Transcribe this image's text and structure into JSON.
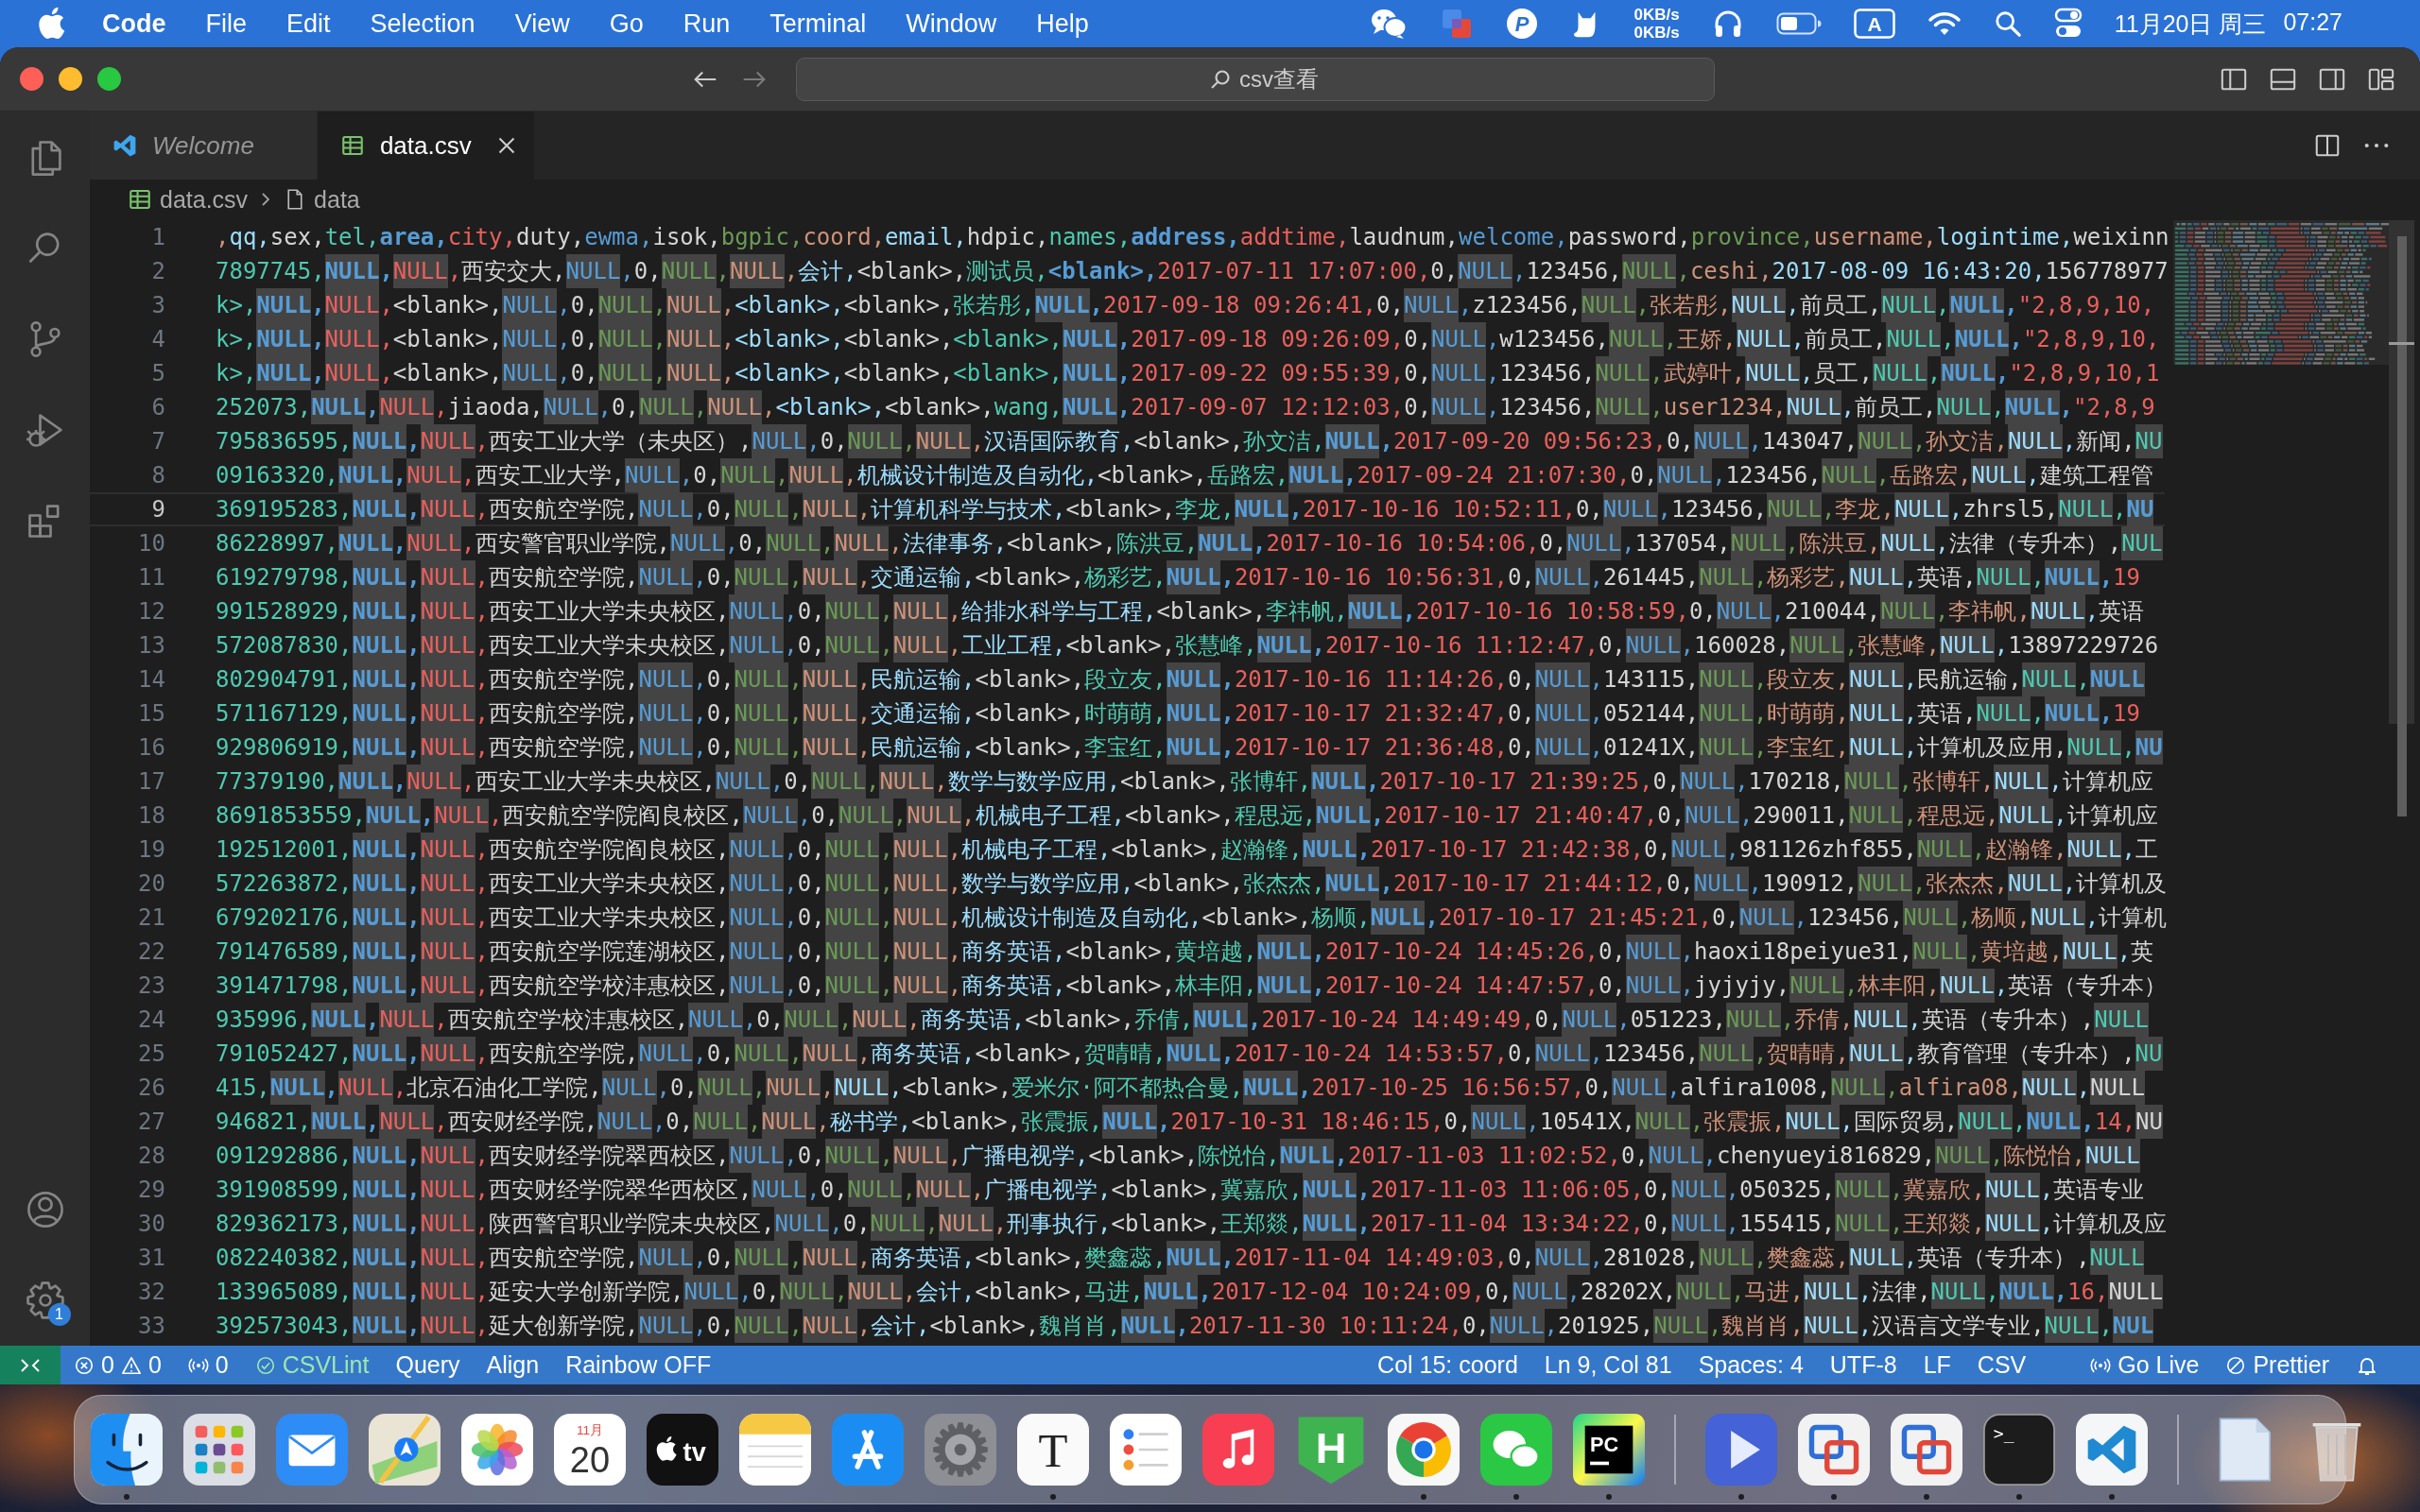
{
  "menu_bar": {
    "app_name": "Code",
    "menus": [
      "File",
      "Edit",
      "Selection",
      "View",
      "Go",
      "Run",
      "Terminal",
      "Window",
      "Help"
    ],
    "tray_letter": "P",
    "network_speed": [
      "0KB/s",
      "0KB/s"
    ],
    "input_source": "A",
    "date": "11月20日 周三",
    "time": "07:27"
  },
  "title_bar": {
    "command_center": "csv查看"
  },
  "activity_bar": {
    "settings_badge": "1"
  },
  "tabs": [
    {
      "label": "Welcome",
      "kind": "welcome",
      "selected": false,
      "preview": true
    },
    {
      "label": "data.csv",
      "kind": "csv",
      "selected": true,
      "preview": false
    }
  ],
  "breadcrumbs": [
    {
      "label": "data.csv",
      "kind": "csv"
    },
    {
      "label": "data",
      "kind": "symbol"
    }
  ],
  "editor": {
    "lines": [
      {
        "number": "1",
        "kind": "header",
        "current": false,
        "text": ",qq,sex,tel,area,city,duty,ewma,isok,bgpic,coord,email,hdpic,names,address,addtime,laudnum,welcome,password,province,username,logintime,weixinn",
        "highlighted": [
          false,
          false,
          false,
          false,
          false,
          false,
          false,
          false,
          false,
          false,
          false,
          false,
          false,
          false,
          false,
          false,
          false,
          false,
          false,
          false,
          false,
          false,
          false
        ]
      },
      {
        "number": "2",
        "kind": "record",
        "current": false,
        "text": "7897745,NULL,NULL,西安交大,NULL,0,NULL,NULL,会计,<blank>,测试员,<blank>,2017-07-11 17:07:00,0,NULL,123456,NULL,ceshi,2017-08-09 16:43:20,156778977",
        "highlighted": [
          false,
          true,
          true,
          false,
          true,
          false,
          true,
          true,
          false,
          false,
          false,
          false,
          false,
          false,
          true,
          false,
          true,
          false,
          false,
          false
        ]
      },
      {
        "number": "3",
        "kind": "record",
        "current": false,
        "text": "k>,NULL,NULL,<blank>,NULL,0,NULL,NULL,<blank>,<blank>,张若彤,NULL,2017-09-18 09:26:41,0,NULL,z123456,NULL,张若彤,NULL,前员工,NULL,NULL,\"2,8,9,10,",
        "highlighted": [
          false,
          true,
          true,
          false,
          true,
          false,
          true,
          true,
          false,
          false,
          false,
          true,
          false,
          false,
          true,
          false,
          true,
          false,
          true,
          false,
          true,
          true,
          false
        ]
      },
      {
        "number": "4",
        "kind": "record",
        "current": false,
        "text": "k>,NULL,NULL,<blank>,NULL,0,NULL,NULL,<blank>,<blank>,<blank>,NULL,2017-09-18 09:26:09,0,NULL,w123456,NULL,王娇,NULL,前员工,NULL,NULL,\"2,8,9,10,",
        "highlighted": [
          false,
          true,
          true,
          false,
          true,
          false,
          true,
          true,
          false,
          false,
          false,
          true,
          false,
          false,
          true,
          false,
          true,
          false,
          true,
          false,
          true,
          true,
          false
        ]
      },
      {
        "number": "5",
        "kind": "record",
        "current": false,
        "text": "k>,NULL,NULL,<blank>,NULL,0,NULL,NULL,<blank>,<blank>,<blank>,NULL,2017-09-22 09:55:39,0,NULL,123456,NULL,武婷叶,NULL,员工,NULL,NULL,\"2,8,9,10,1",
        "highlighted": [
          false,
          true,
          true,
          false,
          true,
          false,
          true,
          true,
          false,
          false,
          false,
          true,
          false,
          false,
          true,
          false,
          true,
          false,
          true,
          false,
          true,
          true,
          false
        ]
      },
      {
        "number": "6",
        "kind": "record",
        "current": false,
        "text": "252073,NULL,NULL,jiaoda,NULL,0,NULL,NULL,<blank>,<blank>,wang,NULL,2017-09-07 12:12:03,0,NULL,123456,NULL,user1234,NULL,前员工,NULL,NULL,\"2,8,9",
        "highlighted": [
          false,
          true,
          true,
          false,
          true,
          false,
          true,
          true,
          false,
          false,
          false,
          true,
          false,
          false,
          true,
          false,
          true,
          false,
          true,
          false,
          true,
          true,
          false
        ]
      },
      {
        "number": "7",
        "kind": "record",
        "current": false,
        "text": "795836595,NULL,NULL,西安工业大学（未央区）,NULL,0,NULL,NULL,汉语国际教育,<blank>,孙文洁,NULL,2017-09-20 09:56:23,0,NULL,143047,NULL,孙文洁,NULL,新闻,NU",
        "highlighted": [
          false,
          true,
          true,
          false,
          true,
          false,
          true,
          true,
          false,
          false,
          false,
          true,
          false,
          false,
          true,
          false,
          true,
          false,
          true,
          false,
          true
        ]
      },
      {
        "number": "8",
        "kind": "record",
        "current": false,
        "text": "09163320,NULL,NULL,西安工业大学,NULL,0,NULL,NULL,机械设计制造及自动化,<blank>,岳路宏,NULL,2017-09-24 21:07:30,0,NULL,123456,NULL,岳路宏,NULL,建筑工程管",
        "highlighted": [
          false,
          true,
          true,
          false,
          true,
          false,
          true,
          true,
          false,
          false,
          false,
          true,
          false,
          false,
          true,
          false,
          true,
          false,
          true,
          false
        ]
      },
      {
        "number": "9",
        "kind": "record",
        "current": true,
        "text": "369195283,NULL,NULL,西安航空学院,NULL,0,NULL,NULL,计算机科学与技术,<blank>,李龙,NULL,2017-10-16 10:52:11,0,NULL,123456,NULL,李龙,NULL,zhrsl5,NULL,NU",
        "highlighted": [
          false,
          true,
          true,
          false,
          true,
          false,
          true,
          true,
          false,
          false,
          false,
          true,
          false,
          false,
          true,
          false,
          true,
          false,
          true,
          false,
          true,
          true
        ]
      },
      {
        "number": "10",
        "kind": "record",
        "current": false,
        "text": "86228997,NULL,NULL,西安警官职业学院,NULL,0,NULL,NULL,法律事务,<blank>,陈洪豆,NULL,2017-10-16 10:54:06,0,NULL,137054,NULL,陈洪豆,NULL,法律（专升本）,NUL",
        "highlighted": [
          false,
          true,
          true,
          false,
          true,
          false,
          true,
          true,
          false,
          false,
          false,
          true,
          false,
          false,
          true,
          false,
          true,
          false,
          true,
          false,
          true
        ]
      },
      {
        "number": "11",
        "kind": "record",
        "current": false,
        "text": "619279798,NULL,NULL,西安航空学院,NULL,0,NULL,NULL,交通运输,<blank>,杨彩艺,NULL,2017-10-16 10:56:31,0,NULL,261445,NULL,杨彩艺,NULL,英语,NULL,NULL,19",
        "highlighted": [
          false,
          true,
          true,
          false,
          true,
          false,
          true,
          true,
          false,
          false,
          false,
          true,
          false,
          false,
          true,
          false,
          true,
          false,
          true,
          false,
          true,
          true,
          false
        ]
      },
      {
        "number": "12",
        "kind": "record",
        "current": false,
        "text": "991528929,NULL,NULL,西安工业大学未央校区,NULL,0,NULL,NULL,给排水科学与工程,<blank>,李祎帆,NULL,2017-10-16 10:58:59,0,NULL,210044,NULL,李祎帆,NULL,英语",
        "highlighted": [
          false,
          true,
          true,
          false,
          true,
          false,
          true,
          true,
          false,
          false,
          false,
          true,
          false,
          false,
          true,
          false,
          true,
          false,
          true,
          false
        ]
      },
      {
        "number": "13",
        "kind": "record",
        "current": false,
        "text": "572087830,NULL,NULL,西安工业大学未央校区,NULL,0,NULL,NULL,工业工程,<blank>,张慧峰,NULL,2017-10-16 11:12:47,0,NULL,160028,NULL,张慧峰,NULL,13897229726",
        "highlighted": [
          false,
          true,
          true,
          false,
          true,
          false,
          true,
          true,
          false,
          false,
          false,
          true,
          false,
          false,
          true,
          false,
          true,
          false,
          true,
          false
        ]
      },
      {
        "number": "14",
        "kind": "record",
        "current": false,
        "text": "802904791,NULL,NULL,西安航空学院,NULL,0,NULL,NULL,民航运输,<blank>,段立友,NULL,2017-10-16 11:14:26,0,NULL,143115,NULL,段立友,NULL,民航运输,NULL,NULL",
        "highlighted": [
          false,
          true,
          true,
          false,
          true,
          false,
          true,
          true,
          false,
          false,
          false,
          true,
          false,
          false,
          true,
          false,
          true,
          false,
          true,
          false,
          true,
          true
        ]
      },
      {
        "number": "15",
        "kind": "record",
        "current": false,
        "text": "571167129,NULL,NULL,西安航空学院,NULL,0,NULL,NULL,交通运输,<blank>,时萌萌,NULL,2017-10-17 21:32:47,0,NULL,052144,NULL,时萌萌,NULL,英语,NULL,NULL,19",
        "highlighted": [
          false,
          true,
          true,
          false,
          true,
          false,
          true,
          true,
          false,
          false,
          false,
          true,
          false,
          false,
          true,
          false,
          true,
          false,
          true,
          false,
          true,
          true,
          false
        ]
      },
      {
        "number": "16",
        "kind": "record",
        "current": false,
        "text": "929806919,NULL,NULL,西安航空学院,NULL,0,NULL,NULL,民航运输,<blank>,李宝红,NULL,2017-10-17 21:36:48,0,NULL,01241X,NULL,李宝红,NULL,计算机及应用,NULL,NU",
        "highlighted": [
          false,
          true,
          true,
          false,
          true,
          false,
          true,
          true,
          false,
          false,
          false,
          true,
          false,
          false,
          true,
          false,
          true,
          false,
          true,
          false,
          true,
          true
        ]
      },
      {
        "number": "17",
        "kind": "record",
        "current": false,
        "text": "77379190,NULL,NULL,西安工业大学未央校区,NULL,0,NULL,NULL,数学与数学应用,<blank>,张博轩,NULL,2017-10-17 21:39:25,0,NULL,170218,NULL,张博轩,NULL,计算机应",
        "highlighted": [
          false,
          true,
          true,
          false,
          true,
          false,
          true,
          true,
          false,
          false,
          false,
          true,
          false,
          false,
          true,
          false,
          true,
          false,
          true,
          false
        ]
      },
      {
        "number": "18",
        "kind": "record",
        "current": false,
        "text": "8691853559,NULL,NULL,西安航空学院阎良校区,NULL,0,NULL,NULL,机械电子工程,<blank>,程思远,NULL,2017-10-17 21:40:47,0,NULL,290011,NULL,程思远,NULL,计算机应",
        "highlighted": [
          false,
          true,
          true,
          false,
          true,
          false,
          true,
          true,
          false,
          false,
          false,
          true,
          false,
          false,
          true,
          false,
          true,
          false,
          true,
          false
        ]
      },
      {
        "number": "19",
        "kind": "record",
        "current": false,
        "text": "192512001,NULL,NULL,西安航空学院阎良校区,NULL,0,NULL,NULL,机械电子工程,<blank>,赵瀚锋,NULL,2017-10-17 21:42:38,0,NULL,981126zhf855,NULL,赵瀚锋,NULL,工",
        "highlighted": [
          false,
          true,
          true,
          false,
          true,
          false,
          true,
          true,
          false,
          false,
          false,
          true,
          false,
          false,
          true,
          false,
          true,
          false,
          true,
          false
        ]
      },
      {
        "number": "20",
        "kind": "record",
        "current": false,
        "text": "572263872,NULL,NULL,西安工业大学未央校区,NULL,0,NULL,NULL,数学与数学应用,<blank>,张杰杰,NULL,2017-10-17 21:44:12,0,NULL,190912,NULL,张杰杰,NULL,计算机及",
        "highlighted": [
          false,
          true,
          true,
          false,
          true,
          false,
          true,
          true,
          false,
          false,
          false,
          true,
          false,
          false,
          true,
          false,
          true,
          false,
          true,
          false
        ]
      },
      {
        "number": "21",
        "kind": "record",
        "current": false,
        "text": "679202176,NULL,NULL,西安工业大学未央校区,NULL,0,NULL,NULL,机械设计制造及自动化,<blank>,杨顺,NULL,2017-10-17 21:45:21,0,NULL,123456,NULL,杨顺,NULL,计算机",
        "highlighted": [
          false,
          true,
          true,
          false,
          true,
          false,
          true,
          true,
          false,
          false,
          false,
          true,
          false,
          false,
          true,
          false,
          true,
          false,
          true,
          false
        ]
      },
      {
        "number": "22",
        "kind": "record",
        "current": false,
        "text": "791476589,NULL,NULL,西安航空学院莲湖校区,NULL,0,NULL,NULL,商务英语,<blank>,黄培越,NULL,2017-10-24 14:45:26,0,NULL,haoxi18peiyue31,NULL,黄培越,NULL,英",
        "highlighted": [
          false,
          true,
          true,
          false,
          true,
          false,
          true,
          true,
          false,
          false,
          false,
          true,
          false,
          false,
          true,
          false,
          true,
          false,
          true,
          false
        ]
      },
      {
        "number": "23",
        "kind": "record",
        "current": false,
        "text": "391471798,NULL,NULL,西安航空学校沣惠校区,NULL,0,NULL,NULL,商务英语,<blank>,林丰阳,NULL,2017-10-24 14:47:57,0,NULL,jyjyjy,NULL,林丰阳,NULL,英语（专升本）",
        "highlighted": [
          false,
          true,
          true,
          false,
          true,
          false,
          true,
          true,
          false,
          false,
          false,
          true,
          false,
          false,
          true,
          false,
          true,
          false,
          true,
          false
        ]
      },
      {
        "number": "24",
        "kind": "record",
        "current": false,
        "text": "935996,NULL,NULL,西安航空学校沣惠校区,NULL,0,NULL,NULL,商务英语,<blank>,乔倩,NULL,2017-10-24 14:49:49,0,NULL,051223,NULL,乔倩,NULL,英语（专升本）,NULL",
        "highlighted": [
          false,
          true,
          true,
          false,
          true,
          false,
          true,
          true,
          false,
          false,
          false,
          true,
          false,
          false,
          true,
          false,
          true,
          false,
          true,
          false,
          true
        ]
      },
      {
        "number": "25",
        "kind": "record",
        "current": false,
        "text": "791052427,NULL,NULL,西安航空学院,NULL,0,NULL,NULL,商务英语,<blank>,贺晴晴,NULL,2017-10-24 14:53:57,0,NULL,123456,NULL,贺晴晴,NULL,教育管理（专升本）,NU",
        "highlighted": [
          false,
          true,
          true,
          false,
          true,
          false,
          true,
          true,
          false,
          false,
          false,
          true,
          false,
          false,
          true,
          false,
          true,
          false,
          true,
          false,
          true
        ]
      },
      {
        "number": "26",
        "kind": "record",
        "current": false,
        "text": "415,NULL,NULL,北京石油化工学院,NULL,0,NULL,NULL,NULL,<blank>,爱米尔·阿不都热合曼,NULL,2017-10-25 16:56:57,0,NULL,alfira1008,NULL,alfira08,NULL,NULL",
        "highlighted": [
          false,
          true,
          true,
          false,
          true,
          false,
          true,
          true,
          true,
          false,
          false,
          true,
          false,
          false,
          true,
          false,
          true,
          false,
          true,
          true
        ]
      },
      {
        "number": "27",
        "kind": "record",
        "current": false,
        "text": "946821,NULL,NULL,西安财经学院,NULL,0,NULL,NULL,秘书学,<blank>,张震振,NULL,2017-10-31 18:46:15,0,NULL,10541X,NULL,张震振,NULL,国际贸易,NULL,NULL,14,NU",
        "highlighted": [
          false,
          true,
          true,
          false,
          true,
          false,
          true,
          true,
          false,
          false,
          false,
          true,
          false,
          false,
          true,
          false,
          true,
          false,
          true,
          false,
          true,
          true,
          false,
          true
        ]
      },
      {
        "number": "28",
        "kind": "record",
        "current": false,
        "text": "091292886,NULL,NULL,西安财经学院翠西校区,NULL,0,NULL,NULL,广播电视学,<blank>,陈悦怡,NULL,2017-11-03 11:02:52,0,NULL,chenyueyi816829,NULL,陈悦怡,NULL",
        "highlighted": [
          false,
          true,
          true,
          false,
          true,
          false,
          true,
          true,
          false,
          false,
          false,
          true,
          false,
          false,
          true,
          false,
          true,
          false,
          true
        ]
      },
      {
        "number": "29",
        "kind": "record",
        "current": false,
        "text": "391908599,NULL,NULL,西安财经学院翠华西校区,NULL,0,NULL,NULL,广播电视学,<blank>,冀嘉欣,NULL,2017-11-03 11:06:05,0,NULL,050325,NULL,冀嘉欣,NULL,英语专业",
        "highlighted": [
          false,
          true,
          true,
          false,
          true,
          false,
          true,
          true,
          false,
          false,
          false,
          true,
          false,
          false,
          true,
          false,
          true,
          false,
          true,
          false
        ]
      },
      {
        "number": "30",
        "kind": "record",
        "current": false,
        "text": "829362173,NULL,NULL,陕西警官职业学院未央校区,NULL,0,NULL,NULL,刑事执行,<blank>,王郑燚,NULL,2017-11-04 13:34:22,0,NULL,155415,NULL,王郑燚,NULL,计算机及应",
        "highlighted": [
          false,
          true,
          true,
          false,
          true,
          false,
          true,
          true,
          false,
          false,
          false,
          true,
          false,
          false,
          true,
          false,
          true,
          false,
          true,
          false
        ]
      },
      {
        "number": "31",
        "kind": "record",
        "current": false,
        "text": "082240382,NULL,NULL,西安航空学院,NULL,0,NULL,NULL,商务英语,<blank>,樊鑫蕊,NULL,2017-11-04 14:49:03,0,NULL,281028,NULL,樊鑫蕊,NULL,英语（专升本）,NULL",
        "highlighted": [
          false,
          true,
          true,
          false,
          true,
          false,
          true,
          true,
          false,
          false,
          false,
          true,
          false,
          false,
          true,
          false,
          true,
          false,
          true,
          false,
          true
        ]
      },
      {
        "number": "32",
        "kind": "record",
        "current": false,
        "text": "133965089,NULL,NULL,延安大学创新学院,NULL,0,NULL,NULL,会计,<blank>,马进,NULL,2017-12-04 10:24:09,0,NULL,28202X,NULL,马进,NULL,法律,NULL,NULL,16,NULL",
        "highlighted": [
          false,
          true,
          true,
          false,
          true,
          false,
          true,
          true,
          false,
          false,
          false,
          true,
          false,
          false,
          true,
          false,
          true,
          false,
          true,
          false,
          true,
          true,
          false,
          true
        ]
      },
      {
        "number": "33",
        "kind": "record",
        "current": false,
        "text": "392573043,NULL,NULL,延大创新学院,NULL,0,NULL,NULL,会计,<blank>,魏肖肖,NULL,2017-11-30 10:11:24,0,NULL,201925,NULL,魏肖肖,NULL,汉语言文学专业,NULL,NUL",
        "highlighted": [
          false,
          true,
          true,
          false,
          true,
          false,
          true,
          true,
          false,
          false,
          false,
          true,
          false,
          false,
          true,
          false,
          true,
          false,
          true,
          false,
          true,
          true
        ]
      }
    ]
  },
  "status_bar": {
    "left": [
      {
        "kind": "problems",
        "errors": "0",
        "warnings": "0"
      },
      {
        "kind": "ports",
        "text": "0"
      },
      {
        "kind": "check",
        "text": "CSVLint"
      },
      {
        "kind": "plain",
        "text": "Query"
      },
      {
        "kind": "plain",
        "text": "Align"
      },
      {
        "kind": "plain",
        "text": "Rainbow OFF"
      }
    ],
    "right": [
      {
        "kind": "plain",
        "text": "Col 15: coord"
      },
      {
        "kind": "plain",
        "text": "Ln 9, Col 81"
      },
      {
        "kind": "plain",
        "text": "Spaces: 4"
      },
      {
        "kind": "plain",
        "text": "UTF-8"
      },
      {
        "kind": "plain",
        "text": "LF"
      },
      {
        "kind": "plain",
        "text": "CSV"
      },
      {
        "kind": "live",
        "text": "Go Live"
      },
      {
        "kind": "prettier",
        "text": "Prettier"
      }
    ]
  },
  "dock": {
    "sections": [
      {
        "items": [
          {
            "kind": "face",
            "running": true
          },
          {
            "kind": "grid",
            "running": false
          },
          {
            "kind": "envelope",
            "running": false
          },
          {
            "kind": "map",
            "running": false
          },
          {
            "kind": "flower",
            "running": false
          },
          {
            "kind": "calendar",
            "running": false,
            "month": "11月",
            "day": "20"
          },
          {
            "kind": "tv",
            "running": false,
            "text": "tv"
          },
          {
            "kind": "notepad",
            "running": false
          },
          {
            "kind": "astrokes",
            "running": false
          },
          {
            "kind": "gear",
            "running": false
          },
          {
            "kind": "serif",
            "running": true,
            "text": "T"
          },
          {
            "kind": "checklist",
            "running": false
          },
          {
            "kind": "note",
            "running": false
          },
          {
            "kind": "block",
            "running": false,
            "text": "H"
          },
          {
            "kind": "sphere",
            "running": true
          },
          {
            "kind": "chat",
            "running": true
          },
          {
            "kind": "monogram",
            "running": true,
            "text": "PC"
          }
        ]
      },
      {
        "items": [
          {
            "kind": "play",
            "running": true
          },
          {
            "kind": "squares",
            "running": true
          },
          {
            "kind": "squares",
            "running": true
          },
          {
            "kind": "terminal",
            "running": true,
            "text": ">_"
          },
          {
            "kind": "ribbon",
            "running": true
          }
        ]
      },
      {
        "items": [
          {
            "kind": "document",
            "running": false
          },
          {
            "kind": "trash",
            "running": false
          }
        ]
      }
    ]
  }
}
